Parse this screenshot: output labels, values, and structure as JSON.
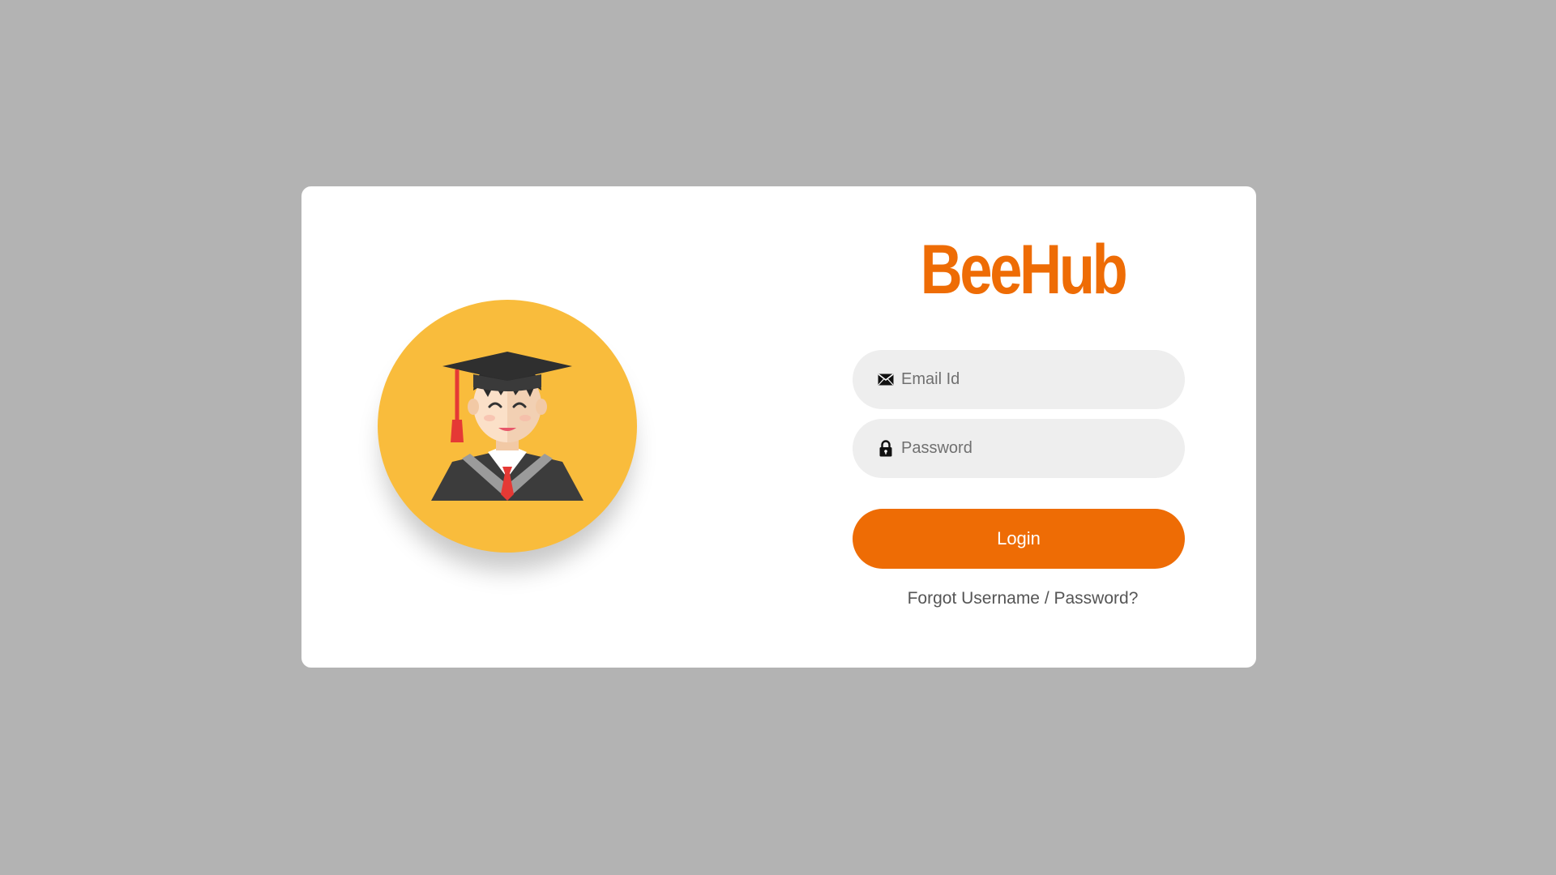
{
  "brand": {
    "name": "BeeHub",
    "color": "#ee6c05"
  },
  "avatar": {
    "icon": "graduate-student-icon",
    "background": "#f9bc3c"
  },
  "form": {
    "email": {
      "placeholder": "Email Id",
      "value": "",
      "icon": "envelope-icon"
    },
    "password": {
      "placeholder": "Password",
      "value": "",
      "icon": "lock-icon"
    },
    "login_label": "Login",
    "forgot_label": "Forgot Username / Password?"
  },
  "colors": {
    "page_background": "#b3b3b3",
    "card_background": "#ffffff",
    "field_background": "#eeeeee",
    "accent": "#ee6c05"
  }
}
